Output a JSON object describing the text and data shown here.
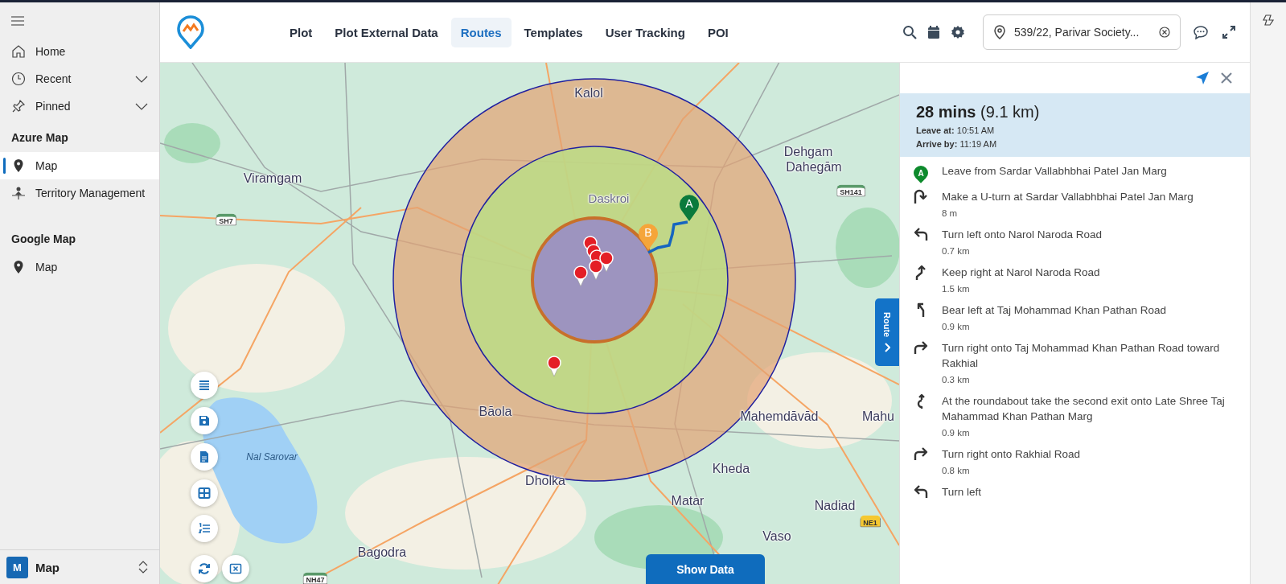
{
  "sidebar": {
    "nav": [
      {
        "label": "Home",
        "kind": "link"
      },
      {
        "label": "Recent",
        "kind": "group",
        "expanded": false
      },
      {
        "label": "Pinned",
        "kind": "group",
        "expanded": false
      }
    ],
    "sections": [
      {
        "title": "Azure Map",
        "items": [
          {
            "label": "Map",
            "kind": "pin",
            "selected": true
          },
          {
            "label": "Territory Management",
            "kind": "territory",
            "selected": false
          }
        ]
      },
      {
        "title": "Google Map",
        "items": [
          {
            "label": "Map",
            "kind": "pin",
            "selected": false
          }
        ]
      }
    ],
    "footer": {
      "initial": "M",
      "label": "Map"
    }
  },
  "header": {
    "tabs": [
      {
        "label": "Plot",
        "selected": false
      },
      {
        "label": "Plot External Data",
        "selected": false
      },
      {
        "label": "Routes",
        "selected": true
      },
      {
        "label": "Templates",
        "selected": false
      },
      {
        "label": "User Tracking",
        "selected": false
      },
      {
        "label": "POI",
        "selected": false
      }
    ],
    "location": {
      "value": "539/22, Parivar Society..."
    }
  },
  "map": {
    "labels": [
      {
        "text": "Kalol",
        "kind": "town"
      },
      {
        "text": "Dehgam",
        "kind": "town"
      },
      {
        "text": "Dahegām",
        "kind": "town"
      },
      {
        "text": "Viramgam",
        "kind": "town"
      },
      {
        "text": "Daskroi",
        "kind": "area"
      },
      {
        "text": "Bāola",
        "kind": "town"
      },
      {
        "text": "Mahemdāvād",
        "kind": "town"
      },
      {
        "text": "Mahu",
        "kind": "town"
      },
      {
        "text": "Kheda",
        "kind": "town"
      },
      {
        "text": "Dholka",
        "kind": "town"
      },
      {
        "text": "Matar",
        "kind": "town"
      },
      {
        "text": "Nadiad",
        "kind": "town"
      },
      {
        "text": "Vaso",
        "kind": "town"
      },
      {
        "text": "Bagodra",
        "kind": "town"
      },
      {
        "text": "Nal Sarovar",
        "kind": "water"
      }
    ],
    "shields": [
      {
        "text": "SH7",
        "kind": "state"
      },
      {
        "text": "SH141",
        "kind": "state"
      },
      {
        "text": "NH47",
        "kind": "state"
      },
      {
        "text": "NE1",
        "kind": "national"
      }
    ],
    "markers": [
      {
        "label": "A",
        "color": "#0a7a3c"
      },
      {
        "label": "B",
        "color": "#f5a53a"
      }
    ],
    "route_tab": "Route",
    "show_data": "Show Data"
  },
  "route_panel": {
    "duration": "28 mins",
    "distance": "(9.1 km)",
    "leave_label": "Leave at:",
    "leave_time": "10:51 AM",
    "arrive_label": "Arrive by:",
    "arrive_time": "11:19 AM",
    "steps": [
      {
        "kind": "start",
        "marker": "A",
        "text": "Leave from Sardar Vallabhbhai Patel Jan Marg"
      },
      {
        "kind": "uturn",
        "text": "Make a U-turn at Sardar Vallabhbhai Patel Jan Marg",
        "distance": "8 m"
      },
      {
        "kind": "left",
        "text": "Turn left onto Narol Naroda Road",
        "distance": "0.7 km"
      },
      {
        "kind": "keep_right",
        "text": "Keep right at Narol Naroda Road",
        "distance": "1.5 km"
      },
      {
        "kind": "bear_left",
        "text": "Bear left at Taj Mohammad Khan Pathan Road",
        "distance": "0.9 km"
      },
      {
        "kind": "right",
        "text": "Turn right onto Taj Mohammad Khan Pathan Road toward Rakhial",
        "distance": "0.3 km"
      },
      {
        "kind": "roundabout",
        "text": "At the roundabout take the second exit onto Late Shree Taj Mahammad Khan Pathan Marg",
        "distance": "0.9 km"
      },
      {
        "kind": "right",
        "text": "Turn right onto Rakhial Road",
        "distance": "0.8 km"
      },
      {
        "kind": "left",
        "text": "Turn left"
      }
    ]
  }
}
